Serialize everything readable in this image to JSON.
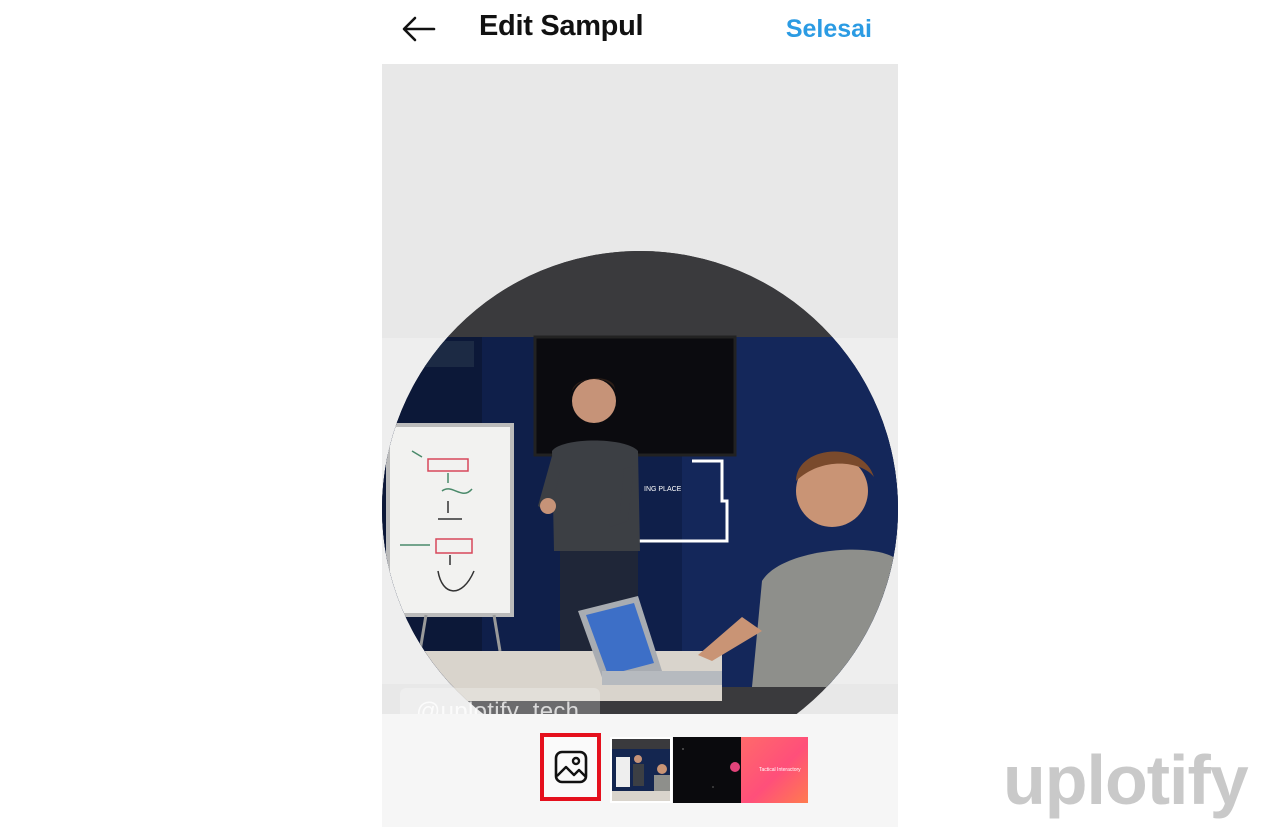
{
  "header": {
    "title": "Edit Sampul",
    "done_label": "Selesai",
    "back_icon": "arrow-left-icon"
  },
  "editor": {
    "handle_text": "@uplotify_tech"
  },
  "bottom_bar": {
    "gallery_icon": "image-icon",
    "thumbnails": [
      {
        "label": ""
      },
      {
        "label": ""
      },
      {
        "label": "Tactical Interactory"
      }
    ]
  },
  "watermark": {
    "text": "uplotify"
  },
  "colors": {
    "accent": "#2b9be3",
    "highlight": "#e5101d",
    "editor_bg": "#e8e8e8"
  }
}
